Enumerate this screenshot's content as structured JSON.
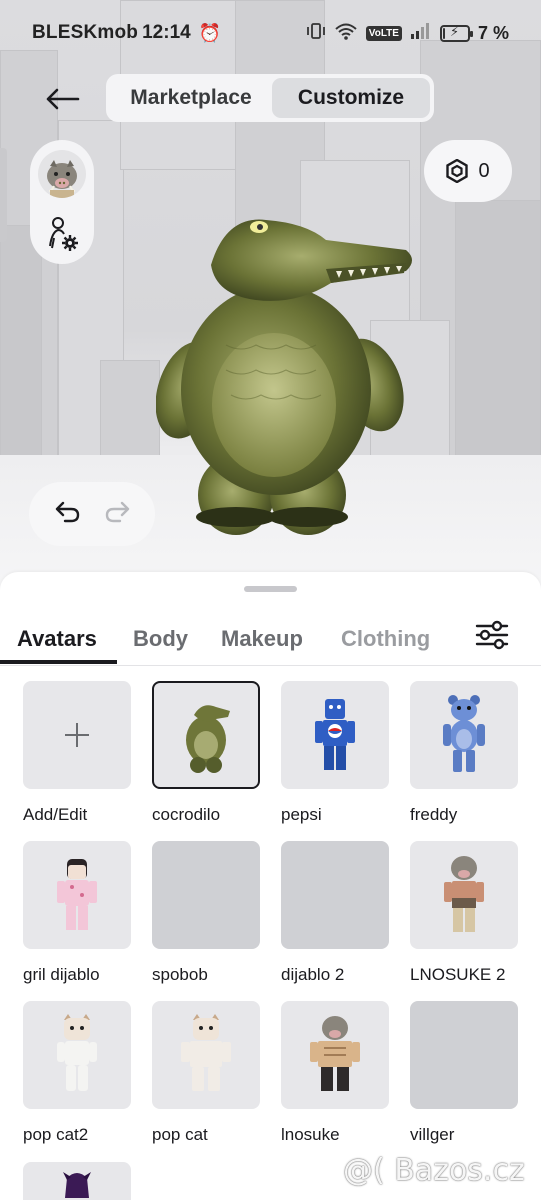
{
  "status_bar": {
    "carrier": "BLESKmob",
    "time": "12:14",
    "network_badge": "VoLTE",
    "battery_percent": "7 %",
    "battery_level": 0.07
  },
  "header": {
    "tabs": [
      {
        "label": "Marketplace",
        "active": false
      },
      {
        "label": "Customize",
        "active": true
      }
    ]
  },
  "robux": {
    "amount": "0",
    "icon": "robux-icon"
  },
  "sheet": {
    "categories": [
      {
        "label": "Avatars",
        "active": true
      },
      {
        "label": "Body",
        "active": false
      },
      {
        "label": "Makeup",
        "active": false
      },
      {
        "label": "Clothing",
        "active": false
      }
    ],
    "avatars": [
      {
        "name": "Add/Edit"
      },
      {
        "name": "cocrodilo"
      },
      {
        "name": "pepsi"
      },
      {
        "name": "freddy"
      },
      {
        "name": "gril dijablo"
      },
      {
        "name": "spobob"
      },
      {
        "name": "dijablo 2"
      },
      {
        "name": "LNOSUKE 2"
      },
      {
        "name": "pop cat2"
      },
      {
        "name": "pop cat"
      },
      {
        "name": "lnosuke"
      },
      {
        "name": "villger"
      }
    ]
  },
  "watermark": "@( Bazos.cz",
  "colors": {
    "selected_border": "#1b1b1f",
    "tile_bg": "#e7e7ea",
    "sheet_bg": "#ffffff"
  }
}
